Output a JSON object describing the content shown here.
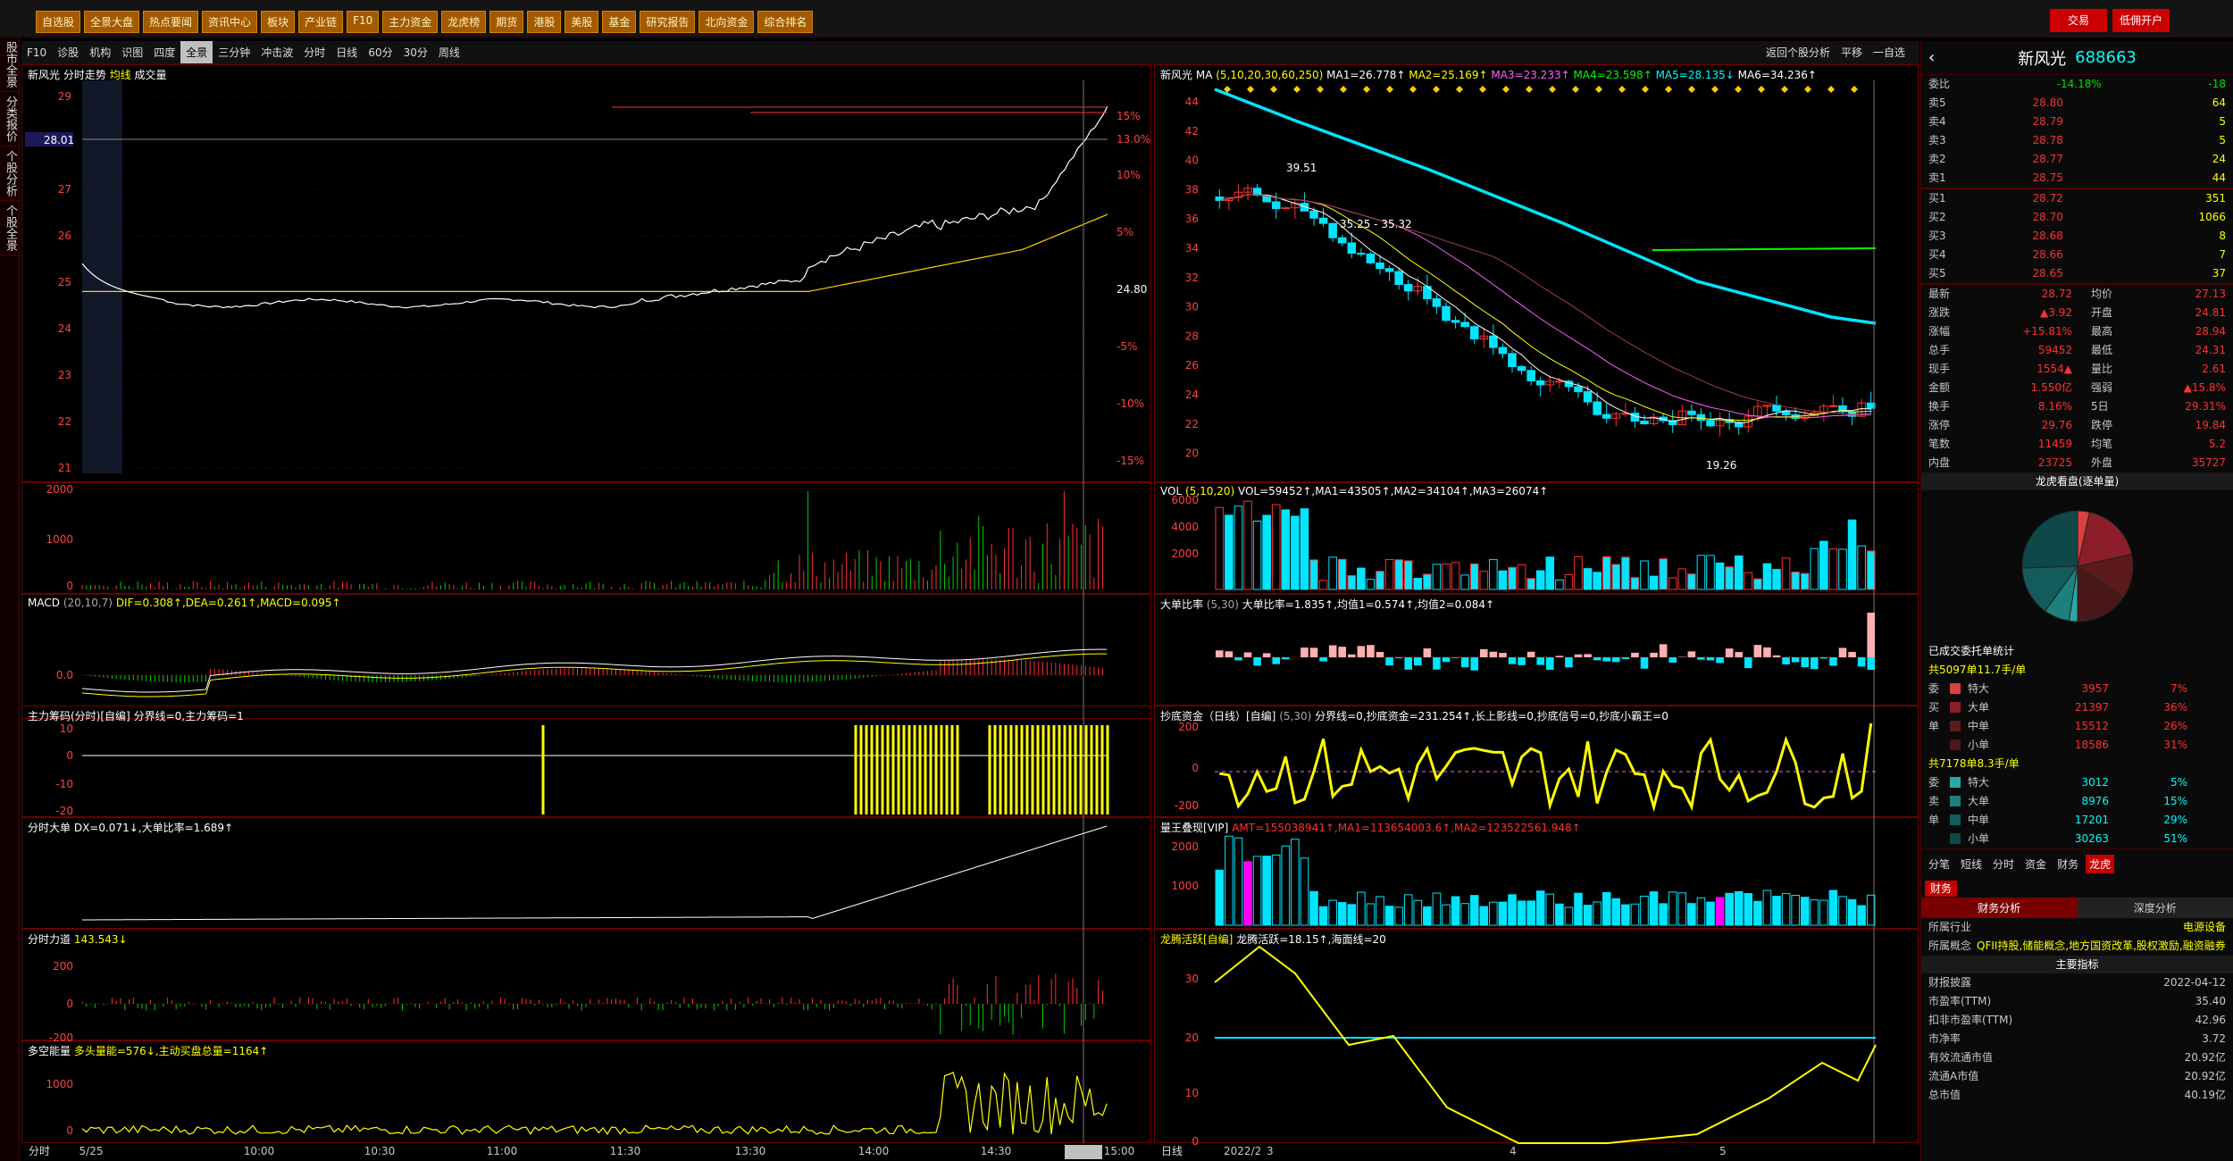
{
  "topbar": {
    "menus": [
      "自选股",
      "全景大盘",
      "热点要闻",
      "资讯中心",
      "板块",
      "产业链",
      "F10",
      "主力资金",
      "龙虎榜",
      "期货",
      "港股",
      "美股",
      "基金",
      "研究报告",
      "北向资金",
      "综合排名"
    ],
    "trade_label": "交易",
    "open_account_label": "低佣开户"
  },
  "leftstrip": [
    "股市全景",
    "分类报价",
    "个股分析",
    "个股全景"
  ],
  "tbar2": {
    "items": [
      "F10",
      "诊股",
      "机构",
      "识图",
      "四度",
      "全景",
      "三分钟",
      "冲击波",
      "分时",
      "日线",
      "60分",
      "30分",
      "周线"
    ],
    "selected": "全景",
    "right": [
      "返回个股分析",
      "平移",
      "一自选"
    ]
  },
  "intraday": {
    "title": "新风光",
    "sub": "分时走势",
    "ma": "均线",
    "vol": "成交量",
    "y_ticks": [
      "29",
      "28",
      "27",
      "26",
      "25",
      "24",
      "23",
      "22",
      "21"
    ],
    "y_current": "28.01",
    "pct_ticks": [
      "15%",
      "13.0%",
      "10%",
      "5%",
      "24.80",
      "-5%",
      "-10%",
      "-15%"
    ],
    "vol_ticks": [
      "2000",
      "1000",
      "0"
    ],
    "macd_title": "MACD",
    "macd_params": "(20,10,7)",
    "macd_vals": "DIF=0.308↑,DEA=0.261↑,MACD=0.095↑",
    "macd_ticks": [
      "0.0"
    ],
    "zl_title": "主力筹码(分时)[自编]",
    "zl_vals": "分界线=0,主力筹码=1",
    "zl_ticks": [
      "10",
      "0",
      "-10",
      "-20"
    ],
    "dd_title": "分时大单",
    "dd_vals": "DX=0.071↓,大单比率=1.689↑",
    "ld_title": "分时力道",
    "ld_vals": "143.543↓",
    "ld_ticks": [
      "200",
      "0",
      "-200"
    ],
    "dk_title": "多空能量",
    "dk_vals": "多头量能=576↓,主动买盘总量=1164↑",
    "dk_ticks": [
      "1000",
      "0"
    ],
    "x_labels": [
      "5/25",
      "10:00",
      "10:30",
      "11:00",
      "11:30",
      "13:30",
      "14:00",
      "14:30",
      "14:55",
      "15:00"
    ],
    "bottom_left": "分时"
  },
  "daily": {
    "title": "新风光",
    "ma_label": "MA",
    "ma_params": "(5,10,20,30,60,250)",
    "ma_vals": [
      {
        "t": "MA1=26.778↑",
        "c": "#ffffff"
      },
      {
        "t": "MA2=25.169↑",
        "c": "#ffff00"
      },
      {
        "t": "MA3=23.233↑",
        "c": "#ff60ff"
      },
      {
        "t": "MA4=23.598↑",
        "c": "#00ff00"
      },
      {
        "t": "MA5=28.135↓",
        "c": "#00ffff"
      },
      {
        "t": "MA6=34.236↑",
        "c": "#ffffff"
      }
    ],
    "y_ticks": [
      "44",
      "42",
      "40",
      "38",
      "36",
      "34",
      "32",
      "30",
      "28",
      "26",
      "24",
      "22",
      "20"
    ],
    "ann_high": "39.51",
    "ann_mid": "35.25 - 35.32",
    "ann_low": "19.26",
    "vol_title": "VOL",
    "vol_params": "(5,10,20)",
    "vol_vals": "VOL=59452↑,MA1=43505↑,MA2=34104↑,MA3=26074↑",
    "vol_ticks": [
      "6000",
      "4000",
      "2000"
    ],
    "dd_title": "大单比率",
    "dd_params": "(5,30)",
    "dd_vals": "大单比率=1.835↑,均值1=0.574↑,均值2=0.084↑",
    "cd_title": "抄底资金（日线）[自编]",
    "cd_params": "(5,30)",
    "cd_vals": "分界线=0,抄底资金=231.254↑,长上影线=0,抄底信号=0,抄底小霸王=0",
    "cd_ticks": [
      "200",
      "0",
      "-200"
    ],
    "lw_title": "量王叠现[VIP]",
    "lw_vals": "AMT=155038941↑,MA1=113654003.6↑,MA2=123522561.948↑",
    "lw_ticks": [
      "2000",
      "1000"
    ],
    "lt_title": "龙腾活跃[自编]",
    "lt_vals": "龙腾活跃=18.15↑,海面线=20",
    "lt_ticks": [
      "30",
      "20",
      "10",
      "0"
    ],
    "x_labels": [
      "2022/2",
      "3",
      "4",
      "5"
    ],
    "bottom_left": "日线"
  },
  "quote": {
    "name": "新风光",
    "code": "688663",
    "wei_label": "委比",
    "wei_val": "-14.18%",
    "wei_vol": "-18",
    "sells": [
      [
        "卖5",
        "28.80",
        "64"
      ],
      [
        "卖4",
        "28.79",
        "5"
      ],
      [
        "卖3",
        "28.78",
        "5"
      ],
      [
        "卖2",
        "28.77",
        "24"
      ],
      [
        "卖1",
        "28.75",
        "44"
      ]
    ],
    "buys": [
      [
        "买1",
        "28.72",
        "351"
      ],
      [
        "买2",
        "28.70",
        "1066"
      ],
      [
        "买3",
        "28.68",
        "8"
      ],
      [
        "买4",
        "28.66",
        "7"
      ],
      [
        "买5",
        "28.65",
        "37"
      ]
    ],
    "stats": [
      [
        "最新",
        "28.72",
        "均价",
        "27.13"
      ],
      [
        "涨跌",
        "▲3.92",
        "开盘",
        "24.81"
      ],
      [
        "涨幅",
        "+15.81%",
        "最高",
        "28.94"
      ],
      [
        "总手",
        "59452",
        "最低",
        "24.31"
      ],
      [
        "现手",
        "1554▲",
        "量比",
        "2.61"
      ],
      [
        "金额",
        "1.550亿",
        "强弱",
        "▲15.8%"
      ],
      [
        "换手",
        "8.16%",
        "5日",
        "29.31%"
      ],
      [
        "涨停",
        "29.76",
        "跌停",
        "19.84"
      ],
      [
        "笔数",
        "11459",
        "均笔",
        "5.2"
      ],
      [
        "内盘",
        "23725",
        "外盘",
        "35727"
      ]
    ],
    "pie_title": "龙虎看盘(逐单量)",
    "pie_slices": [
      {
        "value": 7,
        "color": "#d94040"
      },
      {
        "value": 36,
        "color": "#8b1e2a"
      },
      {
        "value": 26,
        "color": "#5c1a1a"
      },
      {
        "value": 31,
        "color": "#4a1818"
      },
      {
        "value": 5,
        "color": "#2aa8a8"
      },
      {
        "value": 15,
        "color": "#1e7f7f"
      },
      {
        "value": 29,
        "color": "#145c5c"
      },
      {
        "value": 51,
        "color": "#0e4848"
      }
    ],
    "order_title": "已成交委托单统计",
    "buy_total": "共5097单11.7手/单",
    "buy_rows": [
      [
        "特大",
        "3957",
        "7%"
      ],
      [
        "大单",
        "21397",
        "36%"
      ],
      [
        "中单",
        "15512",
        "26%"
      ],
      [
        "小单",
        "18586",
        "31%"
      ]
    ],
    "buy_side": [
      "委",
      "买",
      "单"
    ],
    "sell_total": "共7178单8.3手/单",
    "sell_rows": [
      [
        "特大",
        "3012",
        "5%"
      ],
      [
        "大单",
        "8976",
        "15%"
      ],
      [
        "中单",
        "17201",
        "29%"
      ],
      [
        "小单",
        "30263",
        "51%"
      ]
    ],
    "sell_side": [
      "委",
      "卖",
      "单"
    ],
    "tabs": [
      "分笔",
      "短线",
      "分时",
      "资金",
      "财务",
      "龙虎"
    ],
    "fin_tab": "财务",
    "fin_sub": [
      "财务分析",
      "深度分析"
    ],
    "industry_label": "所属行业",
    "industry": "电源设备",
    "concept_label": "所属概念",
    "concept": "QFII持股,储能概念,地方国资改革,股权激励,融资融券",
    "main_index": "主要指标",
    "fin_rows": [
      [
        "财报披露",
        "2022-04-12"
      ],
      [
        "市盈率(TTM)",
        "35.40"
      ],
      [
        "扣非市盈率(TTM)",
        "42.96"
      ],
      [
        "市净率",
        "3.72"
      ],
      [
        "有效流通市值",
        "20.92亿"
      ],
      [
        "流通A市值",
        "20.92亿"
      ],
      [
        "总市值",
        "40.19亿"
      ]
    ]
  }
}
